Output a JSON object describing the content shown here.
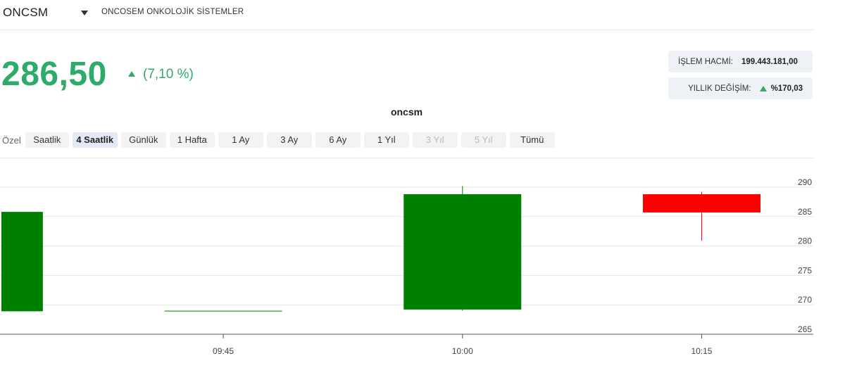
{
  "header": {
    "ticker": "ONCSM",
    "company_name": "ONCOSEM ONKOLOJİK SİSTEMLER",
    "caret_icon": "caret-down-icon"
  },
  "quote": {
    "price": "286,50",
    "change": "(7,10 %)",
    "change_direction": "up",
    "up_color": "#2eaa6a"
  },
  "stats": {
    "volume_label": "İŞLEM HACMİ:",
    "volume_value": "199.443.181,00",
    "yearly_label": "YILLIK DEĞİŞİM:",
    "yearly_value": "%170,03",
    "yearly_direction": "up"
  },
  "ranges": {
    "custom_label": "Özel",
    "buttons": [
      {
        "label": "Saatlik",
        "state": "normal"
      },
      {
        "label": "4 Saatlik",
        "state": "active"
      },
      {
        "label": "Günlük",
        "state": "normal"
      },
      {
        "label": "1 Hafta",
        "state": "normal"
      },
      {
        "label": "1 Ay",
        "state": "normal"
      },
      {
        "label": "3 Ay",
        "state": "normal"
      },
      {
        "label": "6 Ay",
        "state": "normal"
      },
      {
        "label": "1 Yıl",
        "state": "normal"
      },
      {
        "label": "3 Yıl",
        "state": "disabled"
      },
      {
        "label": "5 Yıl",
        "state": "disabled"
      },
      {
        "label": "Tümü",
        "state": "normal"
      }
    ]
  },
  "chart_data": {
    "type": "candlestick",
    "title": "oncsm",
    "ylim": [
      265,
      290
    ],
    "y_ticks": [
      290,
      285,
      280,
      275,
      270,
      265
    ],
    "y_axis_side": "right",
    "x_ticks": [
      "09:45",
      "10:00",
      "10:15"
    ],
    "x_range": [
      "09:31",
      "10:22"
    ],
    "grid": "horizontal",
    "up_color": "#008000",
    "down_color": "#ff0000",
    "candles": [
      {
        "time": "09:30",
        "open": 268.9,
        "high": 285.8,
        "low": 268.9,
        "close": 285.8
      },
      {
        "time": "09:45",
        "open": 269.0,
        "high": 269.0,
        "low": 269.0,
        "close": 269.0
      },
      {
        "time": "10:00",
        "open": 269.2,
        "high": 290.2,
        "low": 269.0,
        "close": 288.8
      },
      {
        "time": "10:15",
        "open": 288.8,
        "high": 289.2,
        "low": 280.9,
        "close": 285.7
      }
    ]
  }
}
